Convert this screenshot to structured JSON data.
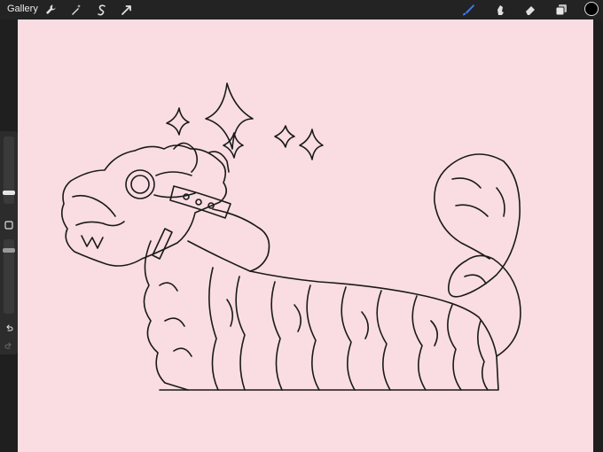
{
  "app": {
    "gallery_label": "Gallery"
  },
  "toolbar": {
    "left_icons": [
      "wrench-icon",
      "magic-wand-icon",
      "selection-icon",
      "transform-arrow-icon"
    ],
    "right_tools": [
      "brush-icon",
      "smudge-icon",
      "eraser-icon",
      "layers-icon"
    ],
    "active_tool": "brush-icon",
    "current_color": "#000000",
    "accent_color": "#3b7cff"
  },
  "sidebar": {
    "brush_size_level": 0.2,
    "opacity_level": 0.2,
    "buttons": [
      "modify-square-icon",
      "undo-icon",
      "redo-icon"
    ]
  },
  "canvas": {
    "background_color": "#f9dde2",
    "line_color": "#1a1a1a"
  }
}
